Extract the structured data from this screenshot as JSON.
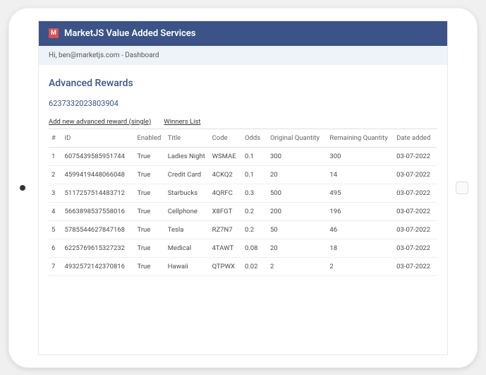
{
  "header": {
    "icon_text": "M",
    "title": "MarketJS Value Added Services"
  },
  "breadcrumb": "Hi, ben@marketjs.com - Dashboard",
  "section_title": "Advanced Rewards",
  "reward_id": "6237332023803904",
  "links": {
    "add_new": "Add new advanced reward (single)",
    "winners": "Winners List"
  },
  "table": {
    "headers": {
      "num": "#",
      "id": "ID",
      "enabled": "Enabled",
      "title": "Title",
      "code": "Code",
      "odds": "Odds",
      "original_qty": "Original Quantity",
      "remaining_qty": "Remaining Quantity",
      "date_added": "Date added"
    },
    "rows": [
      {
        "num": "1",
        "id": "6075439585951744",
        "enabled": "True",
        "title": "Ladies Night",
        "code": "WSMAE",
        "odds": "0.1",
        "original_qty": "300",
        "remaining_qty": "300",
        "date_added": "03-07-2022"
      },
      {
        "num": "2",
        "id": "4599419448066048",
        "enabled": "True",
        "title": "Credit Card",
        "code": "4CKQ2",
        "odds": "0.1",
        "original_qty": "20",
        "remaining_qty": "14",
        "date_added": "03-07-2022"
      },
      {
        "num": "3",
        "id": "5117257514483712",
        "enabled": "True",
        "title": "Starbucks",
        "code": "4QRFC",
        "odds": "0.3",
        "original_qty": "500",
        "remaining_qty": "495",
        "date_added": "03-07-2022"
      },
      {
        "num": "4",
        "id": "5663898537558016",
        "enabled": "True",
        "title": "Cellphone",
        "code": "X8FGT",
        "odds": "0.2",
        "original_qty": "200",
        "remaining_qty": "196",
        "date_added": "03-07-2022"
      },
      {
        "num": "5",
        "id": "5785544627847168",
        "enabled": "True",
        "title": "Tesla",
        "code": "RZ7N7",
        "odds": "0.2",
        "original_qty": "50",
        "remaining_qty": "46",
        "date_added": "03-07-2022"
      },
      {
        "num": "6",
        "id": "6225769615327232",
        "enabled": "True",
        "title": "Medical",
        "code": "4TAWT",
        "odds": "0.08",
        "original_qty": "20",
        "remaining_qty": "18",
        "date_added": "03-07-2022"
      },
      {
        "num": "7",
        "id": "4932572142370816",
        "enabled": "True",
        "title": "Hawaii",
        "code": "QTPWX",
        "odds": "0.02",
        "original_qty": "2",
        "remaining_qty": "2",
        "date_added": "03-07-2022"
      }
    ]
  }
}
